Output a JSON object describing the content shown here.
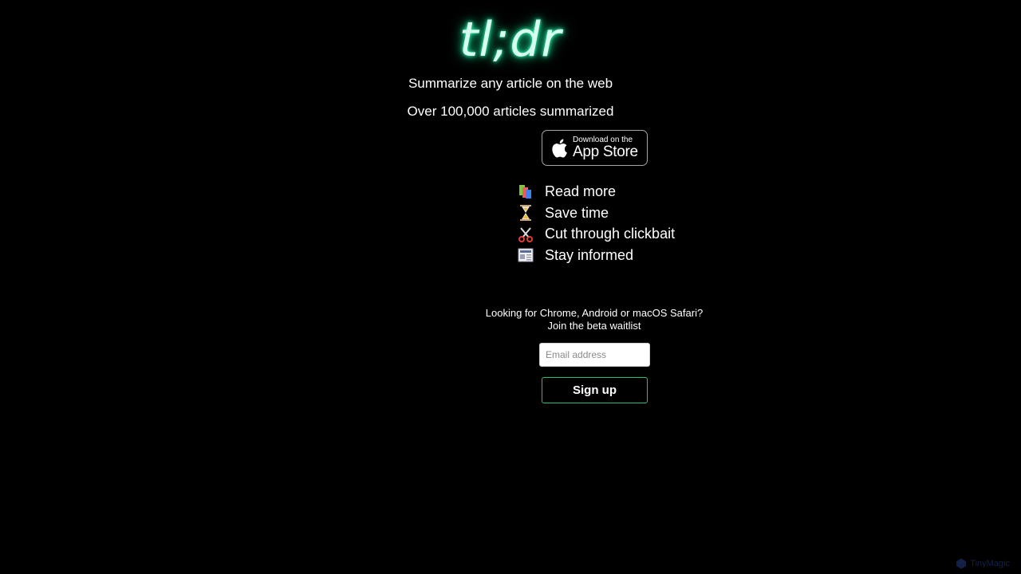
{
  "app": {
    "logo_text": "tl;dr",
    "accent_color": "#19e69a"
  },
  "hero": {
    "tagline": "Summarize any article on the web",
    "stat": "Over 100,000 articles summarized"
  },
  "appstore_badge": {
    "small_text": "Download on the",
    "big_text": "App Store",
    "icon": "apple-icon"
  },
  "features": [
    {
      "icon": "books-icon",
      "label": "Read more"
    },
    {
      "icon": "hourglass-icon",
      "label": "Save time"
    },
    {
      "icon": "scissors-icon",
      "label": "Cut through clickbait"
    },
    {
      "icon": "newspaper-icon",
      "label": "Stay informed"
    }
  ],
  "beta": {
    "question": "Looking for Chrome, Android or macOS Safari?",
    "join_text": "Join the beta waitlist",
    "email_placeholder": "Email address",
    "email_value": "",
    "signup_label": "Sign up",
    "button_border_color": "#27c27a"
  },
  "watermark": {
    "text": "TinyMagic"
  }
}
